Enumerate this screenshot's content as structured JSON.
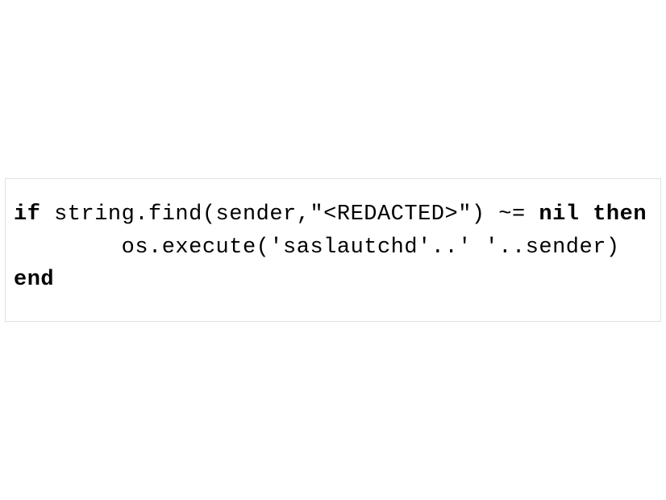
{
  "code": {
    "line1_kw1": "if",
    "line1_text": " string.find(sender,\"<REDACTED>\") ~= ",
    "line1_kw2": "nil then",
    "line2_text": "        os.execute('saslautchd'..' '..sender)",
    "line3_kw": "end"
  }
}
